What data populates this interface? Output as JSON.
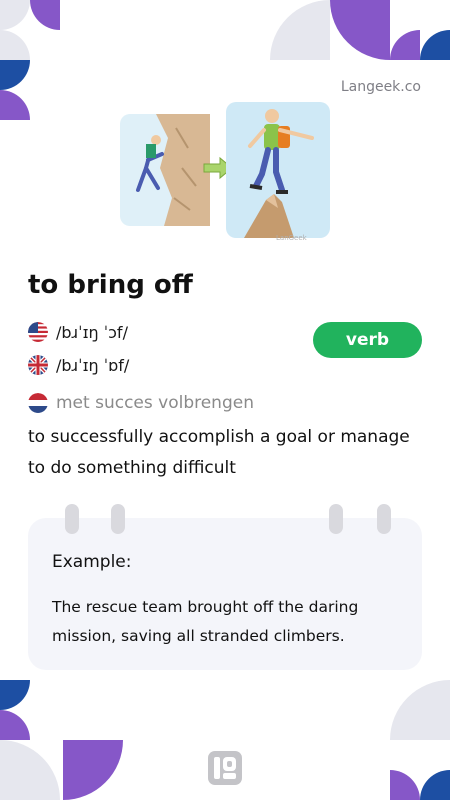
{
  "brand": "Langeek.co",
  "illustration_watermark": "LanGeek",
  "word": "to bring off",
  "pronunciations": [
    {
      "flag": "us-flag-icon",
      "ipa": "/bɹˈɪŋ ˈɔf/"
    },
    {
      "flag": "uk-flag-icon",
      "ipa": "/bɹˈɪŋ ˈɒf/"
    }
  ],
  "part_of_speech": "verb",
  "translation": {
    "flag": "netherlands-flag-icon",
    "text": "met succes volbrengen"
  },
  "definition": "to successfully accomplish a goal or manage to do something difficult",
  "example": {
    "label": "Example:",
    "text": "The rescue team brought off the daring mission, saving all stranded climbers."
  },
  "colors": {
    "accent_purple": "#8657c8",
    "accent_blue": "#1d4fa3",
    "light_gray": "#e6e7ee",
    "verb_green": "#21b35d"
  }
}
